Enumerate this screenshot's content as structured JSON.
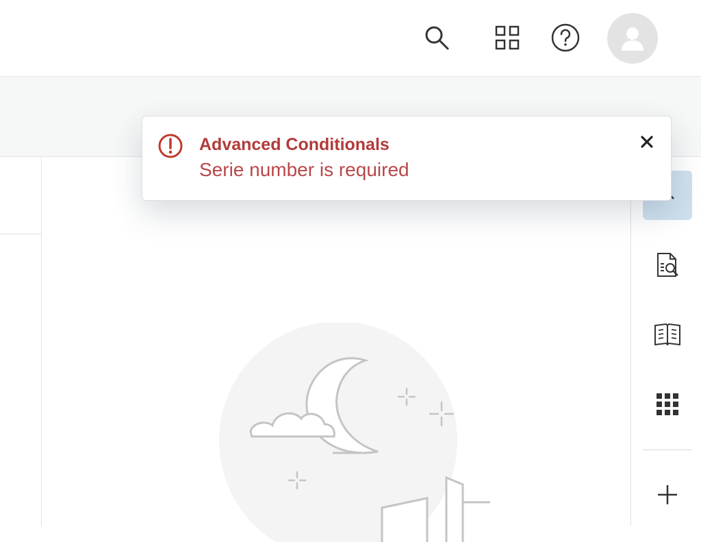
{
  "header": {
    "icons": {
      "search": "search-icon",
      "apps": "apps-grid-icon",
      "help": "help-icon",
      "avatar": "user-avatar-icon"
    }
  },
  "right_rail": {
    "icons": [
      "chevron-up-icon",
      "document-search-icon",
      "book-icon",
      "grid-icon",
      "plus-icon"
    ]
  },
  "toast": {
    "title": "Advanced Conditionals",
    "message": "Serie number is required",
    "severity": "error",
    "accent_color": "#b33a3a",
    "close_icon": "close-icon"
  }
}
